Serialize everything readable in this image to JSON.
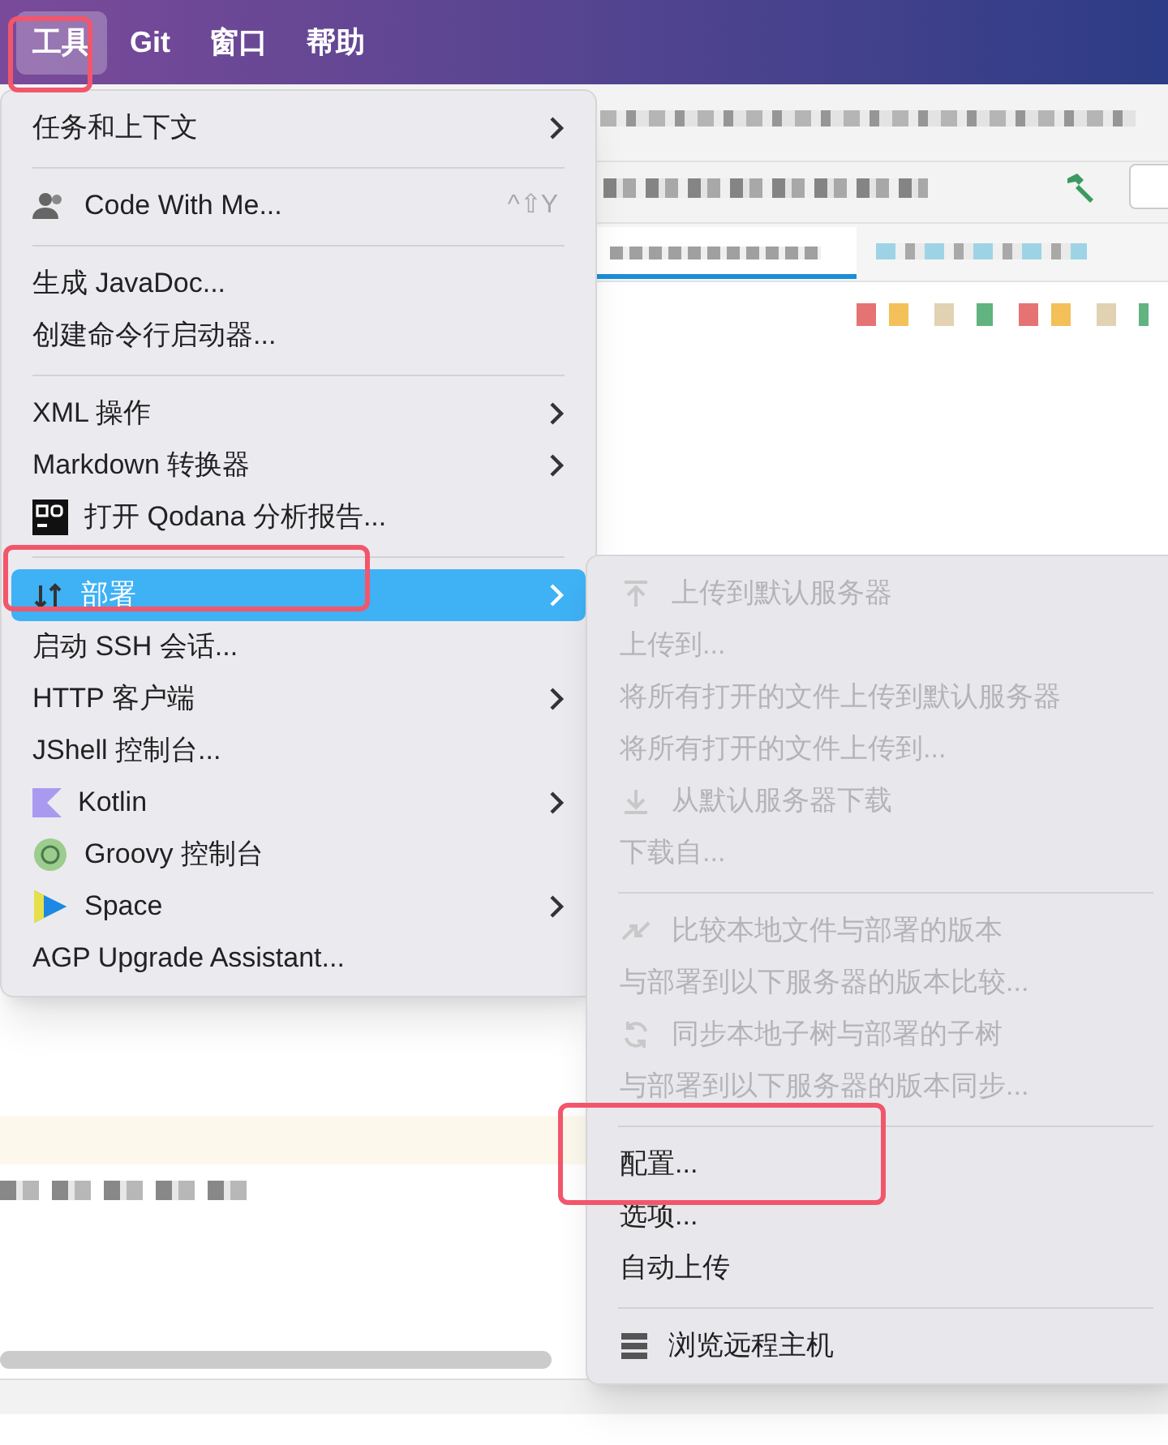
{
  "menubar": [
    {
      "label": "工具",
      "selected": true
    },
    {
      "label": "Git",
      "selected": false
    },
    {
      "label": "窗口",
      "selected": false
    },
    {
      "label": "帮助",
      "selected": false
    }
  ],
  "tools_menu": [
    {
      "kind": "item",
      "label": "任务和上下文",
      "submenu": true,
      "selected": false
    },
    {
      "kind": "separator"
    },
    {
      "kind": "item",
      "label": "Code With Me...",
      "shortcut": "^⇧Y",
      "submenu": false,
      "selected": false
    },
    {
      "kind": "separator"
    },
    {
      "kind": "item",
      "label": "生成 JavaDoc...",
      "submenu": false,
      "selected": false
    },
    {
      "kind": "item",
      "label": "创建命令行启动器...",
      "submenu": false,
      "selected": false
    },
    {
      "kind": "separator"
    },
    {
      "kind": "item",
      "label": "XML 操作",
      "submenu": true,
      "selected": false
    },
    {
      "kind": "item",
      "label": "Markdown 转换器",
      "submenu": true,
      "selected": false
    },
    {
      "kind": "item",
      "label": "打开 Qodana 分析报告...",
      "submenu": false,
      "selected": false
    },
    {
      "kind": "separator"
    },
    {
      "kind": "item",
      "label": "部署",
      "submenu": true,
      "selected": true
    },
    {
      "kind": "item",
      "label": "启动 SSH 会话...",
      "submenu": false,
      "selected": false
    },
    {
      "kind": "item",
      "label": "HTTP 客户端",
      "submenu": true,
      "selected": false
    },
    {
      "kind": "item",
      "label": "JShell 控制台...",
      "submenu": false,
      "selected": false
    },
    {
      "kind": "item",
      "label": "Kotlin",
      "submenu": true,
      "selected": false
    },
    {
      "kind": "item",
      "label": "Groovy 控制台",
      "submenu": false,
      "selected": false
    },
    {
      "kind": "item",
      "label": "Space",
      "submenu": true,
      "selected": false
    },
    {
      "kind": "item",
      "label": "AGP Upgrade Assistant...",
      "submenu": false,
      "selected": false
    }
  ],
  "deploy_submenu": [
    {
      "kind": "item",
      "label": "上传到默认服务器",
      "disabled": true
    },
    {
      "kind": "item",
      "label": "上传到...",
      "disabled": true
    },
    {
      "kind": "item",
      "label": "将所有打开的文件上传到默认服务器",
      "disabled": true
    },
    {
      "kind": "item",
      "label": "将所有打开的文件上传到...",
      "disabled": true
    },
    {
      "kind": "item",
      "label": "从默认服务器下载",
      "disabled": true
    },
    {
      "kind": "item",
      "label": "下载自...",
      "disabled": true
    },
    {
      "kind": "separator"
    },
    {
      "kind": "item",
      "label": "比较本地文件与部署的版本",
      "disabled": true
    },
    {
      "kind": "item",
      "label": "与部署到以下服务器的版本比较...",
      "disabled": true
    },
    {
      "kind": "item",
      "label": "同步本地子树与部署的子树",
      "disabled": true
    },
    {
      "kind": "item",
      "label": "与部署到以下服务器的版本同步...",
      "disabled": true
    },
    {
      "kind": "separator"
    },
    {
      "kind": "item",
      "label": "配置...",
      "disabled": false
    },
    {
      "kind": "item",
      "label": "选项...",
      "disabled": false
    },
    {
      "kind": "item",
      "label": "自动上传",
      "disabled": false
    },
    {
      "kind": "separator"
    },
    {
      "kind": "item",
      "label": "浏览远程主机",
      "disabled": false
    }
  ]
}
